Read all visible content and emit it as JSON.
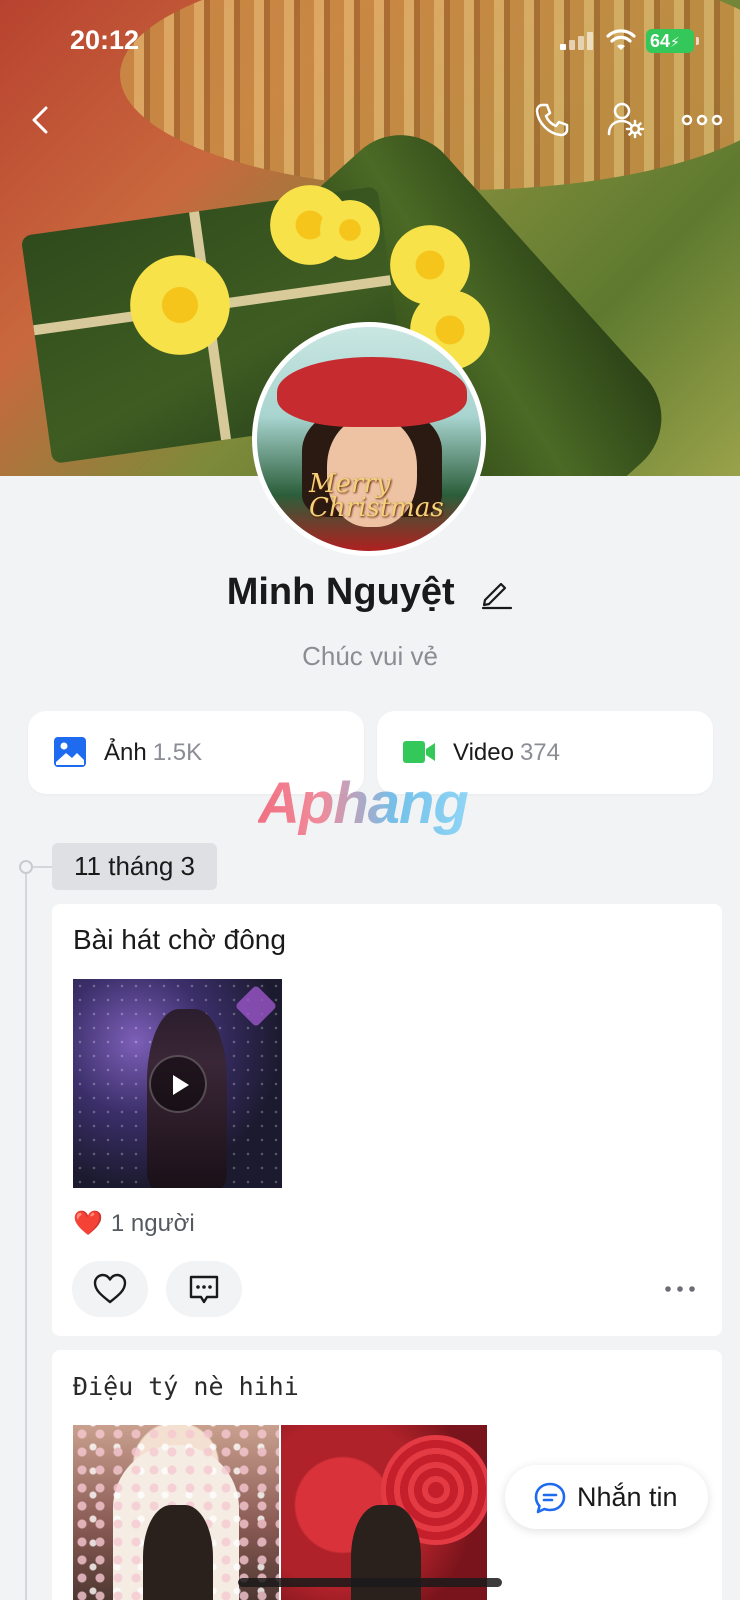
{
  "status_bar": {
    "time": "20:12",
    "battery_level": "64"
  },
  "profile": {
    "name": "Minh Nguyệt",
    "status": "Chúc vui vẻ",
    "avatar_overlay_text": "Merry Christmas"
  },
  "media": {
    "photos_label": "Ảnh",
    "photos_count": "1.5K",
    "videos_label": "Video",
    "videos_count": "374"
  },
  "watermark": "Aphang",
  "timeline": {
    "date": "11 tháng 3"
  },
  "posts": [
    {
      "title": "Bài hát chờ đông",
      "reaction_emoji": "❤️",
      "reaction_text": "1 người"
    },
    {
      "title": "Điệu tý nè hihi"
    }
  ],
  "message_button": {
    "label": "Nhắn tin"
  },
  "colors": {
    "accent_blue": "#1e6bf0",
    "video_green": "#34c759",
    "battery_green": "#34c759",
    "heart_red": "#e0202e"
  },
  "icons": [
    "back-icon",
    "phone-icon",
    "user-settings-icon",
    "more-icon",
    "edit-icon",
    "photo-icon",
    "video-icon",
    "play-icon",
    "heart-icon",
    "comment-icon",
    "chat-icon"
  ]
}
